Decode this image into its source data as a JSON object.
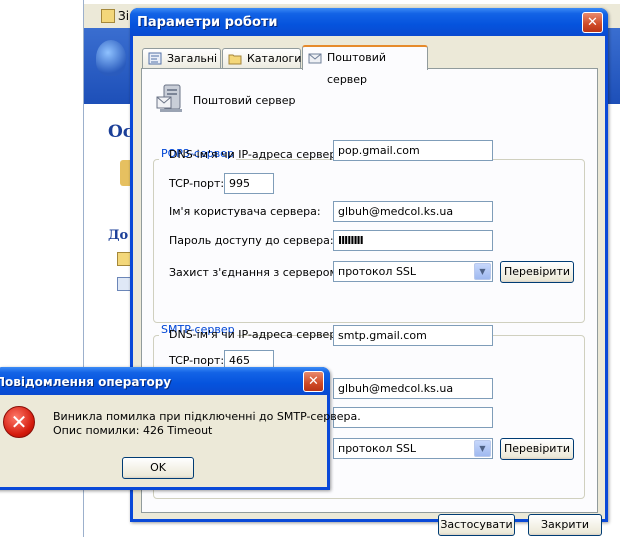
{
  "background": {
    "toolbar_fragment": "Зі",
    "heading1_fragment": "Ос",
    "heading2_fragment": "До"
  },
  "dialog": {
    "title": "Параметри роботи",
    "close_glyph": "✕",
    "tabs": [
      {
        "label": "Загальні"
      },
      {
        "label": "Каталоги"
      },
      {
        "label": "Поштовий сервер"
      }
    ],
    "panel_title": "Поштовий сервер",
    "pop3": {
      "legend": "POP3-сервер",
      "dns_label": "DNS-ім'я чи IP-адреса сервера:",
      "dns_value": "pop.gmail.com",
      "port_label": "TCP-порт:",
      "port_value": "995",
      "user_label": "Ім'я користувача сервера:",
      "user_value": "glbuh@medcol.ks.ua",
      "password_label": "Пароль доступу до сервера:",
      "password_value": "IIIIIIII",
      "security_label": "Захист з'єднання з сервером:",
      "security_value": "протокол SSL",
      "check_button": "Перевірити"
    },
    "smtp": {
      "legend": "SMTP-сервер",
      "dns_label": "DNS-ім'я чи IP-адреса сервера:",
      "dns_value": "smtp.gmail.com",
      "port_label": "TCP-порт:",
      "port_value": "465",
      "user_value": "glbuh@medcol.ks.ua",
      "password_value": "",
      "security_value": "протокол SSL",
      "check_button": "Перевірити"
    },
    "apply_button": "Застосувати",
    "close_button": "Закрити"
  },
  "message_box": {
    "title": "Повідомлення оператору",
    "close_glyph": "✕",
    "icon_glyph": "✕",
    "line1": "Виникла помилка при підключенні до SMTP-сервера.",
    "line2": "Опис помилки: 426 Timeout",
    "ok_button": "OK"
  },
  "icons": [
    "error-icon",
    "close-icon",
    "dropdown-arrow-icon",
    "mail-server-icon",
    "folder-icon",
    "settings-icon"
  ],
  "colors": {
    "titlebar": "#0553dd",
    "dialog_face": "#ece9d8",
    "group_legend": "#0046d5",
    "active_tab_accent": "#e68b2c",
    "error_red": "#d41b0d"
  }
}
